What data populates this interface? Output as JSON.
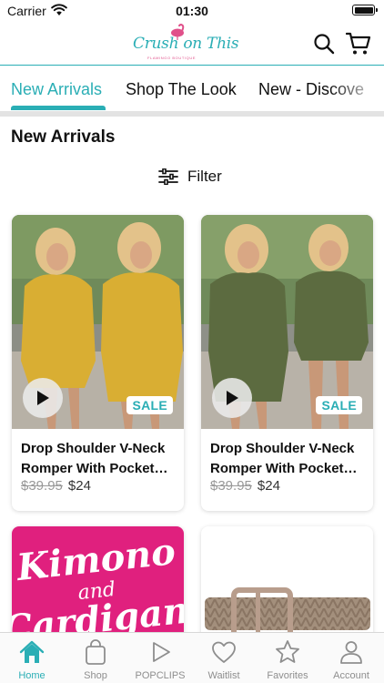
{
  "status_bar": {
    "carrier": "Carrier",
    "time": "01:30"
  },
  "header": {
    "logo_text": "Crush on This",
    "logo_subtext": "FLAMINGO BOUTIQUE",
    "icons": [
      "search-icon",
      "cart-icon"
    ]
  },
  "tabs": [
    {
      "label": "New Arrivals",
      "active": true
    },
    {
      "label": "Shop The Look",
      "active": false
    },
    {
      "label": "New - Discove",
      "active": false
    }
  ],
  "section_title": "New Arrivals",
  "filter": {
    "label": "Filter",
    "icon": "filter-sliders-icon"
  },
  "products": [
    {
      "title": "Drop Shoulder V-Neck Romper With Pocket…",
      "old_price": "$39.95",
      "price": "$24",
      "badge": "SALE",
      "color": "#d9ae33"
    },
    {
      "title": "Drop Shoulder V-Neck Romper With Pocket…",
      "old_price": "$39.95",
      "price": "$24",
      "badge": "SALE",
      "color": "#5c6b40"
    }
  ],
  "promo": {
    "line1": "Kimono",
    "line2": "and",
    "line3": "Cardigan"
  },
  "bottom_nav": [
    {
      "label": "Home",
      "icon": "home-icon",
      "active": true
    },
    {
      "label": "Shop",
      "icon": "shopping-bag-icon",
      "active": false
    },
    {
      "label": "POPCLIPS",
      "icon": "play-icon",
      "active": false
    },
    {
      "label": "Waitlist",
      "icon": "heart-icon",
      "active": false
    },
    {
      "label": "Favorites",
      "icon": "star-icon",
      "active": false
    },
    {
      "label": "Account",
      "icon": "user-icon",
      "active": false
    }
  ],
  "colors": {
    "accent": "#2aaeb5",
    "promo_pink": "#e0207e",
    "inactive": "#8e8e8e"
  }
}
